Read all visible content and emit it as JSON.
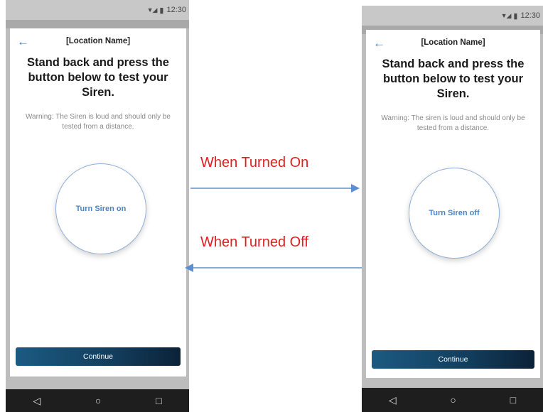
{
  "annotations": {
    "turned_on": "When Turned On",
    "turned_off": "When Turned Off"
  },
  "colors": {
    "annotation_text": "#e02020",
    "arrow": "#5b8fd1",
    "accent_blue": "#4a86c5",
    "continue_button_start": "#1c5a82",
    "continue_button_end": "#0b2238"
  },
  "screens": {
    "left": {
      "status_time": "12:30",
      "location_name": "[Location Name]",
      "headline": "Stand back and press the button below to test your Siren.",
      "warning": "Warning: The Siren is loud and should only be tested from a distance.",
      "siren_button_label": "Turn Siren on",
      "continue_label": "Continue"
    },
    "right": {
      "status_time": "12:30",
      "location_name": "[Location Name]",
      "headline": "Stand back and press the button below to test your Siren.",
      "warning": "Warning: The siren is loud and should only be tested from a distance.",
      "siren_button_label": "Turn Siren off",
      "continue_label": "Continue"
    }
  },
  "icons": {
    "back": "arrow-left",
    "nav_back": "triangle-left",
    "nav_home": "circle",
    "nav_recents": "square"
  }
}
